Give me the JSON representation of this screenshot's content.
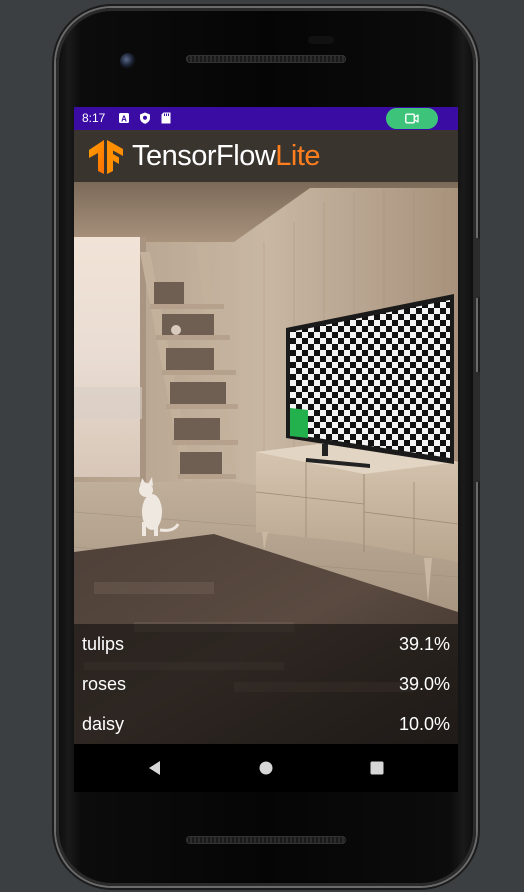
{
  "status_bar": {
    "time": "8:17",
    "icons": [
      "a-notification-icon",
      "shield-icon",
      "sd-card-icon"
    ],
    "camera_indicator": "video-camera-icon",
    "background_color": "#3a0ca3",
    "indicator_color": "#3ec47a"
  },
  "header": {
    "brand_main": "TensorFlow",
    "brand_accent": "Lite",
    "accent_color": "#ff7f1f",
    "logo_icon": "tensorflow-logo-icon"
  },
  "camera_view": {
    "scene": "room with tv and cat"
  },
  "results": [
    {
      "label": "tulips",
      "score": "39.1%"
    },
    {
      "label": "roses",
      "score": "39.0%"
    },
    {
      "label": "daisy",
      "score": "10.0%"
    }
  ],
  "nav": {
    "back_icon": "back-triangle-icon",
    "home_icon": "home-circle-icon",
    "recents_icon": "recents-square-icon"
  }
}
